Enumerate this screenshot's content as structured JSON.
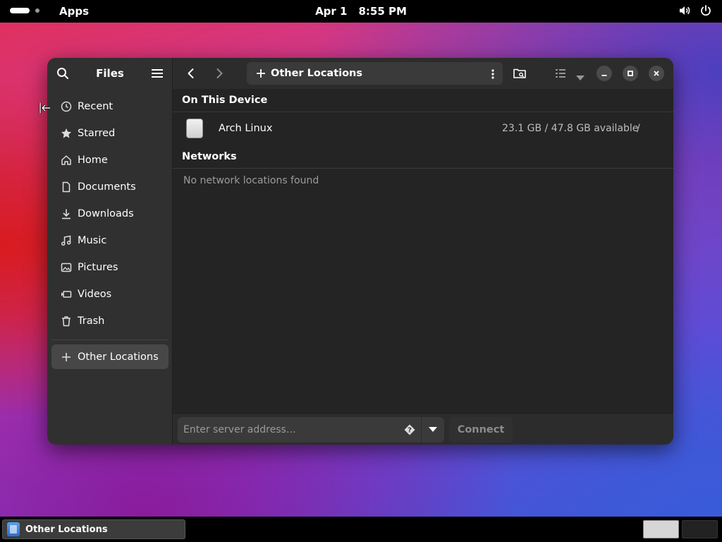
{
  "topbar": {
    "apps_label": "Apps",
    "date": "Apr 1",
    "time": "8:55 PM"
  },
  "window": {
    "sidebar": {
      "title": "Files",
      "items": [
        {
          "label": "Recent",
          "icon": "clock-icon"
        },
        {
          "label": "Starred",
          "icon": "star-icon"
        },
        {
          "label": "Home",
          "icon": "home-icon"
        },
        {
          "label": "Documents",
          "icon": "document-icon"
        },
        {
          "label": "Downloads",
          "icon": "download-icon"
        },
        {
          "label": "Music",
          "icon": "music-icon"
        },
        {
          "label": "Pictures",
          "icon": "picture-icon"
        },
        {
          "label": "Videos",
          "icon": "video-icon"
        },
        {
          "label": "Trash",
          "icon": "trash-icon"
        }
      ],
      "other_locations": "Other Locations"
    },
    "toolbar": {
      "path_label": "Other Locations"
    },
    "main": {
      "device_section": "On This Device",
      "devices": [
        {
          "name": "Arch Linux",
          "space": "23.1 GB / 47.8 GB available",
          "mount": "/"
        }
      ],
      "network_section": "Networks",
      "network_empty": "No network locations found"
    },
    "bottom": {
      "server_placeholder": "Enter server address…",
      "connect_label": "Connect"
    }
  },
  "taskbar": {
    "window_label": "Other Locations"
  }
}
